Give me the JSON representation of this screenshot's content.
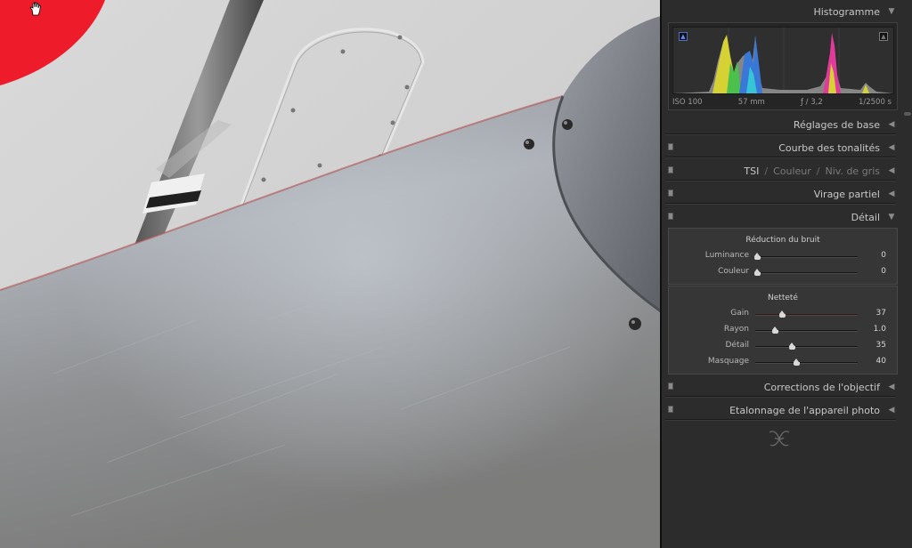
{
  "viewport": {
    "cursor_icon": "hand-cursor-icon"
  },
  "panel": {
    "histogram": {
      "title": "Histogramme",
      "iso": "ISO 100",
      "focal": "57 mm",
      "aperture": "ƒ / 3,2",
      "shutter": "1/2500 s"
    },
    "sections": {
      "basic": "Réglages de base",
      "tone_curve": "Courbe des tonalités",
      "hsl": "TSI",
      "color": "Couleur",
      "grayscale": "Niv. de gris",
      "split_toning": "Virage partiel",
      "detail": "Détail",
      "lens": "Corrections de l'objectif",
      "camera": "Etalonnage de l'appareil photo"
    },
    "noise_reduction": {
      "title": "Réduction du bruit",
      "sliders": [
        {
          "label": "Luminance",
          "value": "0",
          "fraction": 0.0
        },
        {
          "label": "Couleur",
          "value": "0",
          "fraction": 0.0
        }
      ]
    },
    "sharpening": {
      "title": "Netteté",
      "sliders": [
        {
          "label": "Gain",
          "value": "37",
          "fraction": 0.25
        },
        {
          "label": "Rayon",
          "value": "1.0",
          "fraction": 0.18
        },
        {
          "label": "Détail",
          "value": "35",
          "fraction": 0.35
        },
        {
          "label": "Masquage",
          "value": "40",
          "fraction": 0.4
        }
      ]
    }
  },
  "colors": {
    "panel_bg": "#2c2c2c",
    "header_text": "#c8c8c8",
    "accent_red": "#ee1c2a"
  }
}
